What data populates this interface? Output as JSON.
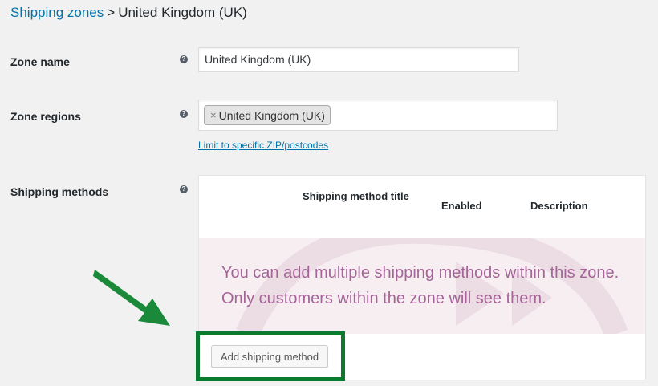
{
  "breadcrumb": {
    "link": "Shipping zones",
    "separator": ">",
    "current": "United Kingdom (UK)"
  },
  "form": {
    "zone_name": {
      "label": "Zone name",
      "value": "United Kingdom (UK)"
    },
    "zone_regions": {
      "label": "Zone regions",
      "chip_remove": "×",
      "chip_label": "United Kingdom (UK)",
      "limit_link": "Limit to specific ZIP/postcodes"
    },
    "shipping_methods": {
      "label": "Shipping methods",
      "columns": [
        "Shipping method title",
        "Enabled",
        "Description"
      ],
      "blank_message": "You can add multiple shipping methods within this zone. Only customers within the zone will see them.",
      "add_button": "Add shipping method"
    },
    "help_glyph": "?"
  },
  "colors": {
    "link": "#0073aa",
    "accent_purple": "#a46497",
    "highlight": "#0a7a2e",
    "arrow": "#1a8a3a"
  }
}
